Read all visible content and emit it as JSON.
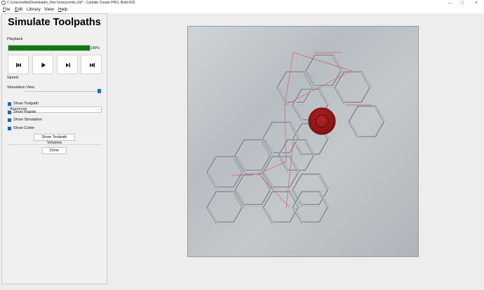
{
  "window": {
    "title": "C:\\Users\\willa\\Downloads\\_Hex honeycomb.c2d* - Carbide Create PRO, Build 816",
    "icon": "carbide-create-app-icon"
  },
  "menu": {
    "items": [
      {
        "label": "File",
        "mnemonic": "F",
        "rest": "ile"
      },
      {
        "label": "Edit",
        "mnemonic": "E",
        "rest": "dit"
      },
      {
        "label": "Library",
        "mnemonic": "",
        "rest": "Library"
      },
      {
        "label": "View",
        "mnemonic": "",
        "rest": "View"
      },
      {
        "label": "Help",
        "mnemonic": "H",
        "rest": "elp"
      }
    ]
  },
  "panel": {
    "title": "Simulate Toolpaths",
    "playback": {
      "label": "Playback",
      "progress_percent": 100,
      "progress_text": "100%",
      "progress_color": "#0e7a0e",
      "buttons": [
        "skip-to-start-icon",
        "play-icon",
        "step-forward-icon",
        "skip-to-end-icon"
      ]
    },
    "speed": {
      "label": "Speed",
      "value_fraction": 1.0
    },
    "simulation_view": {
      "label": "Simulation View",
      "selected": "Aluminum"
    },
    "checkboxes": [
      {
        "label": "Show Toolpath",
        "checked": true
      },
      {
        "label": "Show Rapids",
        "checked": true
      },
      {
        "label": "Show Simulation",
        "checked": true
      },
      {
        "label": "Show Cutter",
        "checked": true
      }
    ],
    "show_volumes_button": "Show Toolpath Volumes",
    "done_button": "Done"
  },
  "viewport": {
    "material": "Aluminum",
    "cutter_color": "#a31d1d",
    "rapid_color": "#e05a6a"
  }
}
